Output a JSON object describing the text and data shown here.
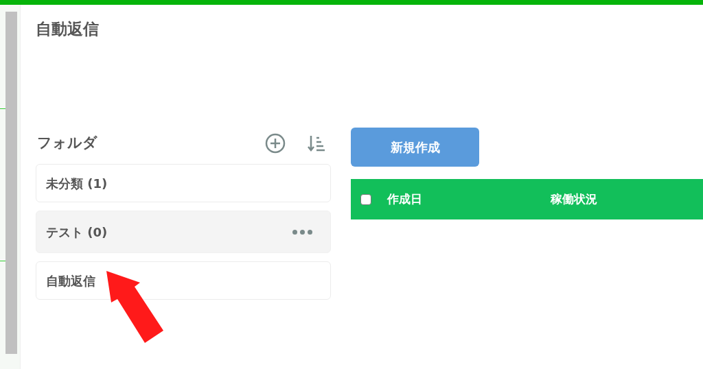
{
  "page_title": "自動返信",
  "folders": {
    "heading": "フォルダ",
    "items": [
      {
        "label": "未分類 (1)",
        "selected": false
      },
      {
        "label": "テスト (0)",
        "selected": true
      },
      {
        "label": "自動返信",
        "selected": false
      }
    ]
  },
  "new_button": "新規作成",
  "table": {
    "select_all_checked": false,
    "columns": [
      "作成日",
      "稼働状況"
    ]
  }
}
